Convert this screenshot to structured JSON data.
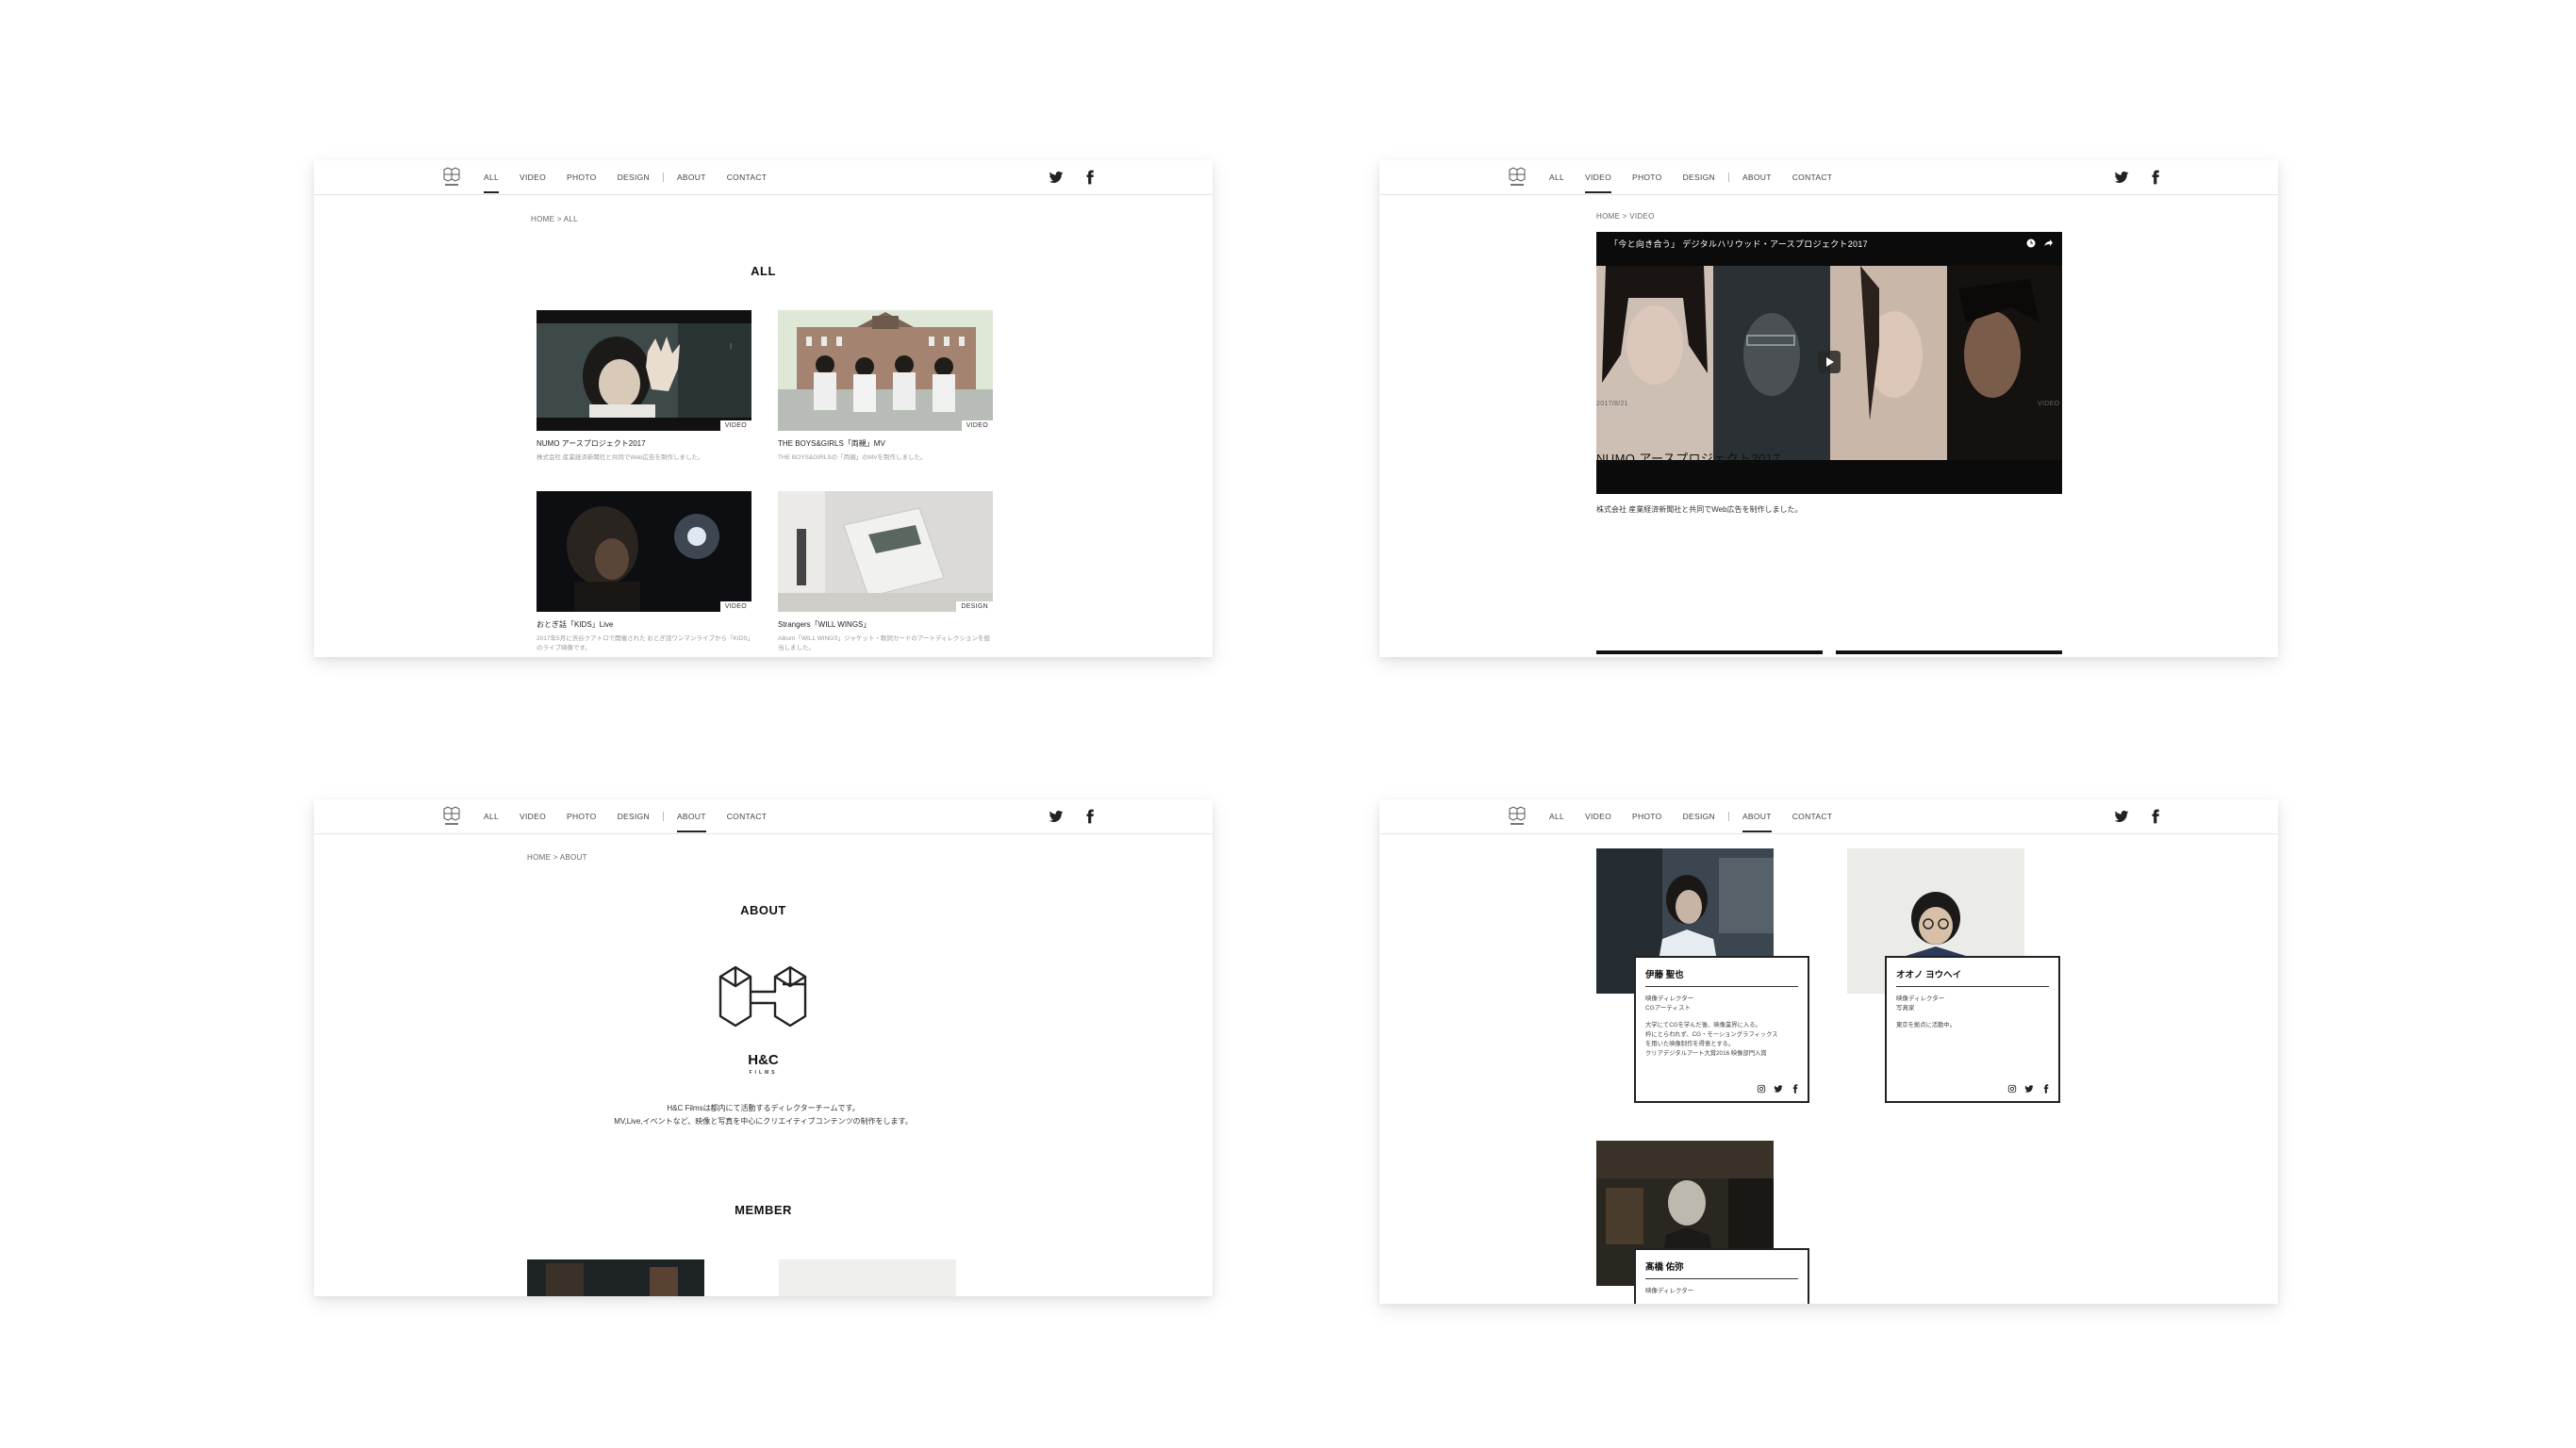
{
  "nav": {
    "items": [
      "ALL",
      "VIDEO",
      "PHOTO",
      "DESIGN",
      "ABOUT",
      "CONTACT"
    ]
  },
  "panel_all": {
    "breadcrumb": "HOME > ALL",
    "title": "ALL",
    "cards": [
      {
        "title": "NUMO アースプロジェクト2017",
        "desc": "株式会社 産業経済新聞社と共同でWeb広告を制作しました。",
        "tag": "VIDEO"
      },
      {
        "title": "THE BOYS&GIRLS「両親」MV",
        "desc": "THE BOYS&GIRLSの「両親」のMVを制作しました。",
        "tag": "VIDEO"
      },
      {
        "title": "おとぎ話「KIDS」Live",
        "desc": "2017年5月に渋谷クアトロで開催された おとぎ話ワンマンライブから「KIDS」のライブ映像です。",
        "tag": "VIDEO"
      },
      {
        "title": "Strangers「WILL WINGS」",
        "desc": "Album「WILL WINGS」ジャケット・歌詞カードのアートディレクションを担当しました。",
        "tag": "DESIGN"
      }
    ]
  },
  "panel_video": {
    "breadcrumb": "HOME > VIDEO",
    "video_title": "「今と向き合う」 デジタルハリウッド・アースプロジェクト2017",
    "date": "2017/8/21",
    "category": "VIDEO",
    "title": "NUMO アースプロジェクト2017",
    "desc": "株式会社 産業経済新聞社と共同でWeb広告を制作しました。"
  },
  "panel_about": {
    "breadcrumb": "HOME > ABOUT",
    "title": "ABOUT",
    "logo_text": "H&C",
    "logo_sub": "FILMS",
    "desc_line1": "H&C Filmsは都内にて活動するディレクターチームです。",
    "desc_line2": "MV,Live,イベントなど、映像と写真を中心にクリエイティブコンテンツの制作をします。",
    "member_title": "MEMBER"
  },
  "panel_members": {
    "members": [
      {
        "name": "伊藤 聖也",
        "role": "映像ディレクター\nCGアーティスト",
        "bio": "大学にてCGを学んだ後、映像業界に入る。\n枠にとらわれず、CG・モーショングラフィックス\nを用いた映像制作を得意とする。\nクリアデジタルアート大賞2016 映像部門入賞"
      },
      {
        "name": "オオノ ヨウヘイ",
        "role": "映像ディレクター\n写真家",
        "bio": "東京を拠点に活動中。"
      },
      {
        "name": "髙橋 佑弥",
        "role": "映像ディレクター",
        "bio": ""
      }
    ]
  },
  "colors": {
    "accent": "#222222",
    "nav_border": "#e4e4e4",
    "muted": "#999999"
  },
  "icons": [
    "logo-icon",
    "twitter-icon",
    "facebook-icon",
    "instagram-icon",
    "play-icon",
    "clock-icon",
    "share-icon"
  ]
}
